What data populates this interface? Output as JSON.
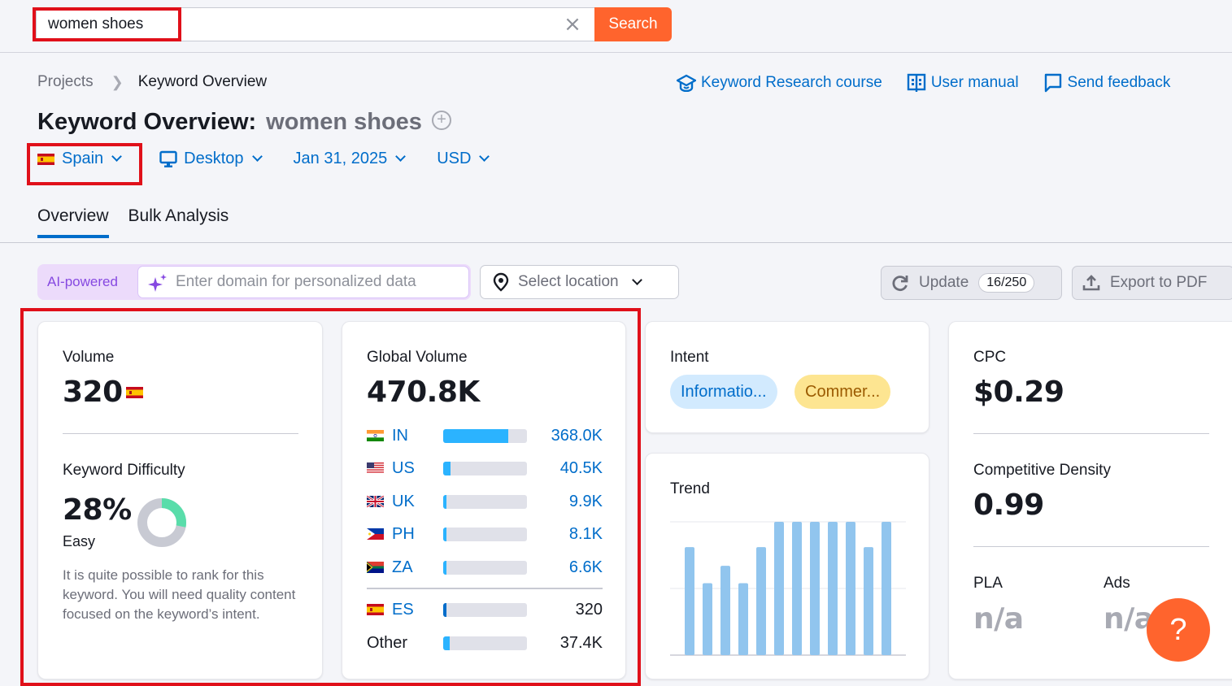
{
  "search": {
    "query": "women shoes",
    "clear_icon": "close-icon",
    "button_label": "Search"
  },
  "breadcrumb": {
    "parent": "Projects",
    "current": "Keyword Overview"
  },
  "help_links": [
    {
      "label": "Keyword Research course",
      "icon": "graduation-cap-icon"
    },
    {
      "label": "User manual",
      "icon": "book-icon"
    },
    {
      "label": "Send feedback",
      "icon": "chat-icon"
    }
  ],
  "title": {
    "prefix": "Keyword Overview:",
    "keyword": "women shoes"
  },
  "filters": {
    "country": "Spain",
    "device": "Desktop",
    "date": "Jan 31, 2025",
    "currency": "USD"
  },
  "tabs": [
    {
      "label": "Overview",
      "active": true
    },
    {
      "label": "Bulk Analysis",
      "active": false
    }
  ],
  "tools": {
    "ai_label": "AI-powered",
    "domain_placeholder": "Enter domain for personalized data",
    "location_placeholder": "Select location",
    "update_label": "Update",
    "update_count": "16/250",
    "export_label": "Export to PDF"
  },
  "volume": {
    "label": "Volume",
    "value": "320",
    "kd_label": "Keyword Difficulty",
    "kd_value": "28%",
    "kd_percent": 28,
    "kd_level": "Easy",
    "kd_description": "It is quite possible to rank for this keyword. You will need quality content focused on the keyword’s intent.",
    "colors": {
      "kd_fill": "#59ddaa",
      "kd_track": "#c8cad3"
    }
  },
  "global_volume": {
    "label": "Global Volume",
    "value": "470.8K",
    "countries": [
      {
        "code": "IN",
        "value": "368.0K",
        "share": 0.78
      },
      {
        "code": "US",
        "value": "40.5K",
        "share": 0.086
      },
      {
        "code": "UK",
        "value": "9.9K",
        "share": 0.021
      },
      {
        "code": "PH",
        "value": "8.1K",
        "share": 0.017
      },
      {
        "code": "ZA",
        "value": "6.6K",
        "share": 0.014
      }
    ],
    "current": {
      "code": "ES",
      "value": "320",
      "share": 0.001
    },
    "other": {
      "label": "Other",
      "value": "37.4K",
      "share": 0.079
    }
  },
  "intent": {
    "label": "Intent",
    "tags": [
      {
        "label": "Informatio...",
        "color": "#d2eafe"
      },
      {
        "label": "Commer...",
        "color": "#fde591"
      }
    ]
  },
  "trend": {
    "label": "Trend",
    "relative_values": [
      0.81,
      0.54,
      0.67,
      0.54,
      0.81,
      1.0,
      1.0,
      1.0,
      1.0,
      1.0,
      0.81,
      1.0
    ],
    "bar_color": "#91c5ee"
  },
  "cpc": {
    "label": "CPC",
    "value": "$0.29",
    "density_label": "Competitive Density",
    "density_value": "0.99",
    "pla_label": "PLA",
    "pla_value": "n/a",
    "ads_label": "Ads",
    "ads_value": "n/a"
  },
  "help_fab": {
    "label": "?"
  }
}
